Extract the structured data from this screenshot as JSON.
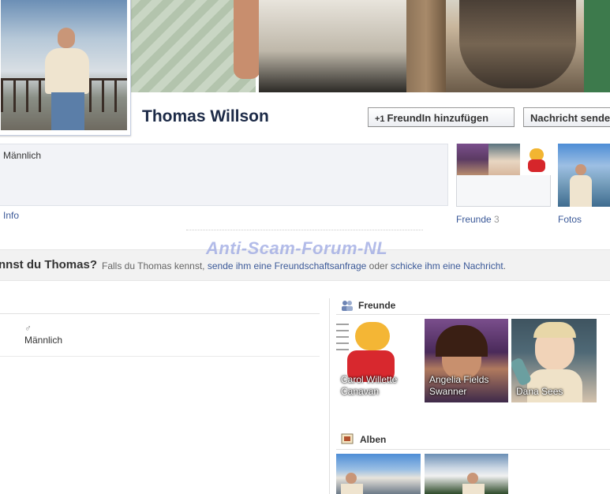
{
  "profile": {
    "name": "Thomas Willson",
    "gender": "Männlich",
    "info_link": "Info"
  },
  "actions": {
    "add_friend": "FreundIn hinzufügen",
    "send_message": "Nachricht senden"
  },
  "friends_box": {
    "label": "Freunde",
    "count": "3"
  },
  "photos_box": {
    "label": "Fotos"
  },
  "watermark": "Anti-Scam-Forum-NL",
  "prompt": {
    "question": "nnst du Thomas?",
    "lead": "Falls du Thomas kennst,",
    "link1": "sende ihm eine Freundschaftsanfrage",
    "mid": "oder",
    "link2": "schicke ihm eine Nachricht",
    "end": "."
  },
  "about": {
    "gender_symbol": "♂",
    "gender": "Männlich"
  },
  "friends_section": {
    "title": "Freunde",
    "friends": [
      {
        "name": "Carol Willette Canavan"
      },
      {
        "name": "Angelia Fields Swanner"
      },
      {
        "name": "Dana Sees"
      }
    ]
  },
  "albums_section": {
    "title": "Alben"
  }
}
